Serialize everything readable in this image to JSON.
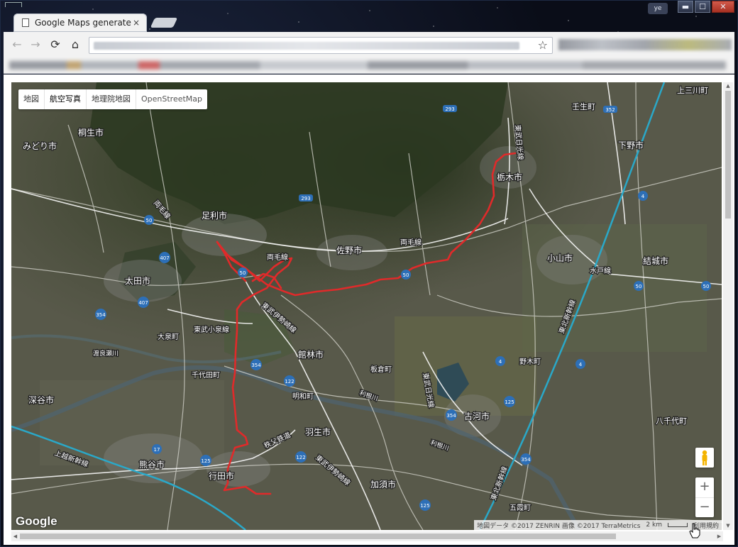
{
  "browser": {
    "tab_title": "Google Maps generate",
    "profile_label": "ye",
    "window_controls": {
      "minimize": "▬",
      "maximize": "☐",
      "close": "✕"
    }
  },
  "toolbar": {
    "back_icon": "←",
    "forward_icon": "→",
    "reload_icon": "⟳",
    "home_icon": "⌂",
    "bookmark_star": "☆"
  },
  "map": {
    "maptype_buttons": [
      {
        "label": "地図"
      },
      {
        "label": "航空写真"
      },
      {
        "label": "地理院地図"
      },
      {
        "label": "OpenStreetMap"
      }
    ],
    "active_maptype": "航空写真",
    "labels": [
      {
        "text": "桐生市"
      },
      {
        "text": "みどり市"
      },
      {
        "text": "足利市"
      },
      {
        "text": "佐野市"
      },
      {
        "text": "両毛線"
      },
      {
        "text": "太田市"
      },
      {
        "text": "東武小泉線"
      },
      {
        "text": "大泉町"
      },
      {
        "text": "千代田町"
      },
      {
        "text": "館林市"
      },
      {
        "text": "板倉町"
      },
      {
        "text": "明和町"
      },
      {
        "text": "羽生市"
      },
      {
        "text": "秩父鉄道"
      },
      {
        "text": "熊谷市"
      },
      {
        "text": "行田市"
      },
      {
        "text": "加須市"
      },
      {
        "text": "深谷市"
      },
      {
        "text": "上越新幹線"
      },
      {
        "text": "東武伊勢崎線"
      },
      {
        "text": "東武日光線"
      },
      {
        "text": "栃木市"
      },
      {
        "text": "壬生町"
      },
      {
        "text": "下野市"
      },
      {
        "text": "上三川町"
      },
      {
        "text": "小山市"
      },
      {
        "text": "水戸線"
      },
      {
        "text": "結城市"
      },
      {
        "text": "野木町"
      },
      {
        "text": "古河市"
      },
      {
        "text": "八千代町"
      },
      {
        "text": "五霞町"
      },
      {
        "text": "東北新幹線"
      },
      {
        "text": "利根川"
      },
      {
        "text": "渡良瀬川"
      }
    ],
    "route_shields": [
      "293",
      "352",
      "50",
      "407",
      "354",
      "122",
      "125",
      "17",
      "4",
      "50",
      "354",
      "125",
      "4",
      "4",
      "354"
    ],
    "google_logo": "Google",
    "attribution": "地図データ ©2017 ZENRIN 画像 ©2017 TerraMetrics",
    "scale": "2 km",
    "terms": "利用規約",
    "zoom_in": "+",
    "zoom_out": "−",
    "colors": {
      "route": "#e02a2a",
      "rail_shinkansen": "#2aa8c8",
      "road_label": "#ffffff"
    }
  }
}
